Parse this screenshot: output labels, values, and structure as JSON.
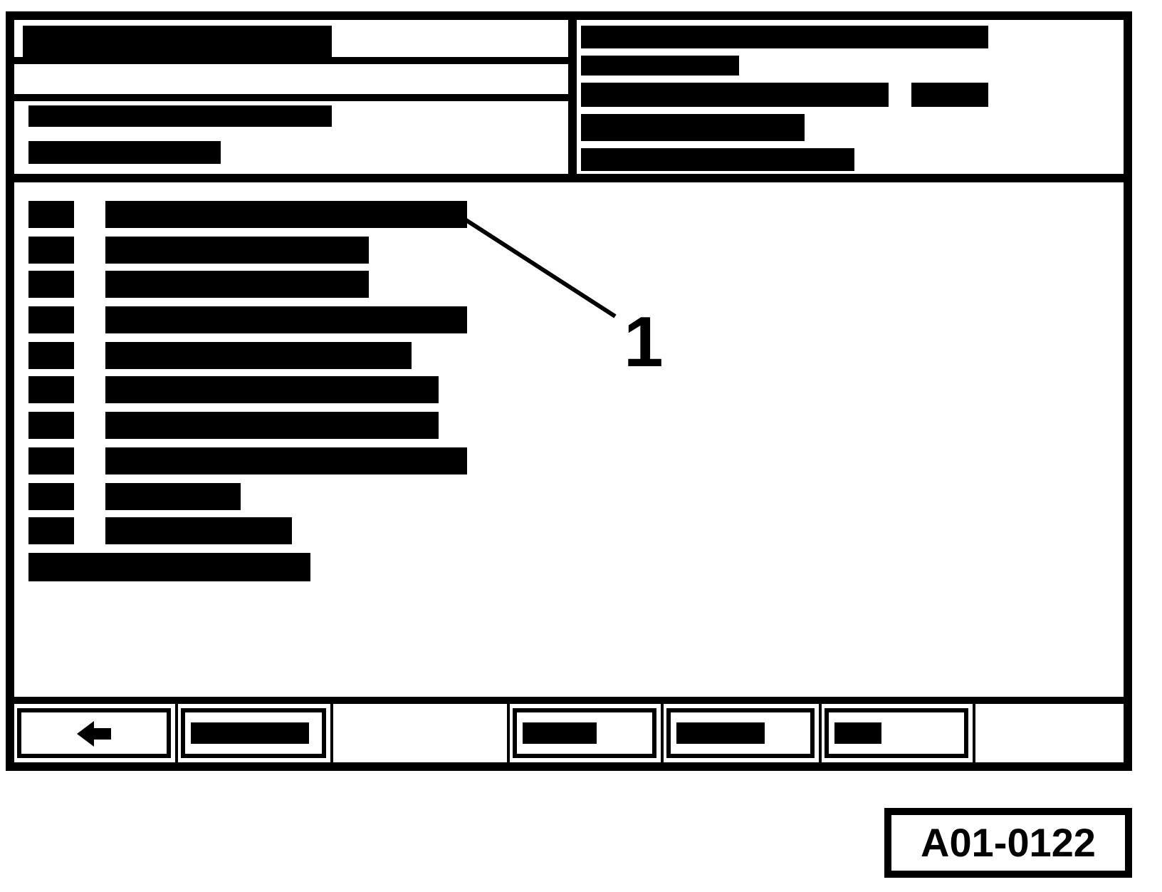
{
  "header": {
    "title_panel": {
      "rows": [
        {
          "kind": "title"
        },
        {
          "kind": "empty"
        },
        {
          "kind": "details"
        }
      ]
    },
    "info_panel": {
      "lines": [
        {
          "kind": "single"
        },
        {
          "kind": "single"
        },
        {
          "kind": "pair"
        },
        {
          "kind": "single"
        },
        {
          "kind": "single"
        }
      ]
    }
  },
  "menu": {
    "items": [
      {
        "kind": "numbered"
      },
      {
        "kind": "numbered"
      },
      {
        "kind": "numbered"
      },
      {
        "kind": "numbered"
      },
      {
        "kind": "numbered"
      },
      {
        "kind": "numbered"
      },
      {
        "kind": "numbered"
      },
      {
        "kind": "numbered"
      },
      {
        "kind": "numbered"
      },
      {
        "kind": "numbered"
      },
      {
        "kind": "note"
      }
    ],
    "callout": {
      "label": "1"
    }
  },
  "softkeys": [
    {
      "kind": "back"
    },
    {
      "kind": "labeled"
    },
    {
      "kind": "empty"
    },
    {
      "kind": "labeled"
    },
    {
      "kind": "labeled"
    },
    {
      "kind": "labeled"
    },
    {
      "kind": "empty"
    }
  ],
  "figure_id": "A01-0122"
}
